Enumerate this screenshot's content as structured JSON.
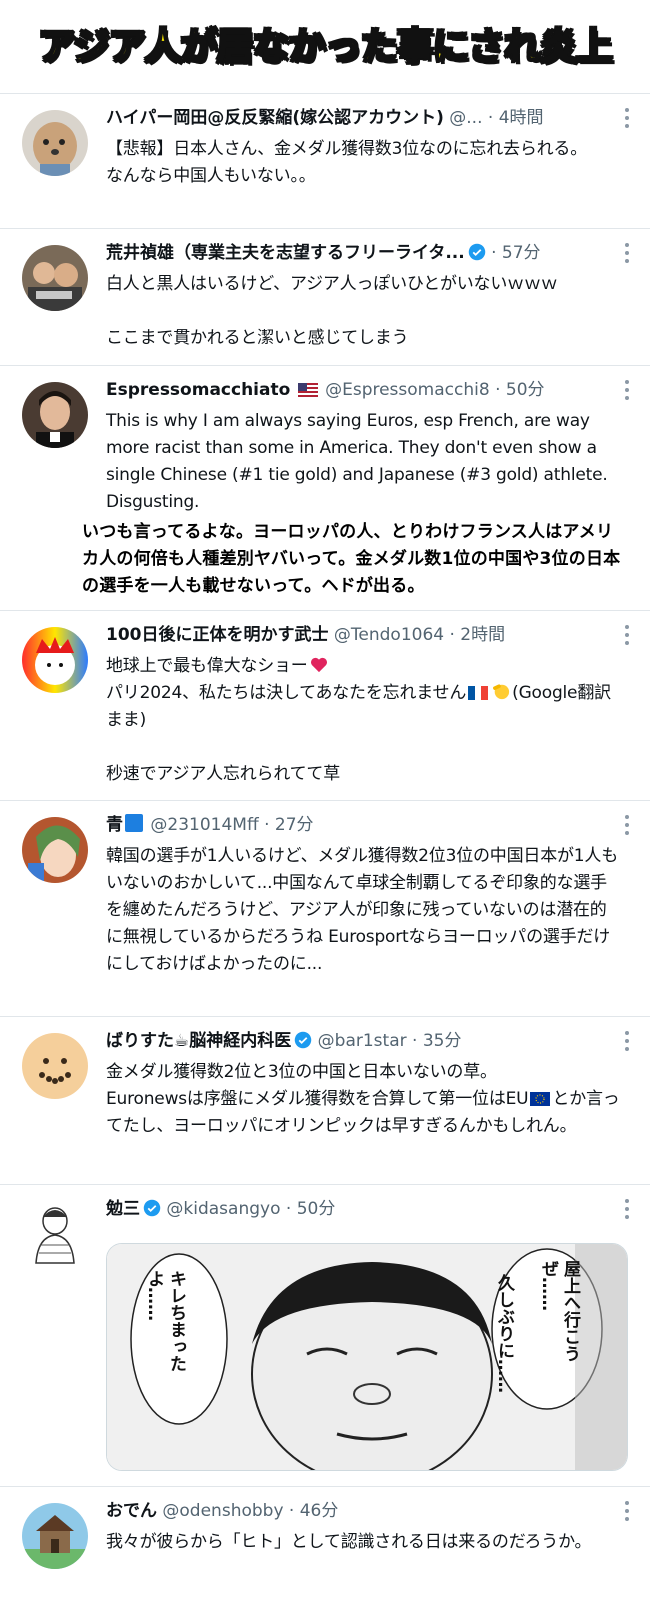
{
  "banner": {
    "title": "アジア人が居なかった事にされ炎上"
  },
  "posts": [
    {
      "name": "ハイパー岡田@反反緊縮(嫁公認アカウント)",
      "handle": "@...",
      "time": "· 4時間",
      "text": "【悲報】日本人さん、金メダル獲得数3位なのに忘れ去られる。\nなんなら中国人もいない。。"
    },
    {
      "name": "荒井禎雄（専業主夫を志望するフリーライタ...",
      "verified": true,
      "time": "· 57分",
      "text": "白人と黒人はいるけど、アジア人っぽいひとがいないｗｗｗ\n\nここまで貫かれると潔いと感じてしまう"
    },
    {
      "name": "Espressomacchiato",
      "flag_icon": "us-flag-icon",
      "handle": "@Espressomacchi8",
      "time": "· 50分",
      "text": "This is why I am always saying Euros, esp French, are way more racist than some in America. They don't even show a single Chinese (#1 tie gold) and Japanese (#3 gold) athlete. Disgusting.",
      "translation": "いつも言ってるよな。ヨーロッパの人、とりわけフランス人はアメリカ人の何倍も人種差別ヤバいって。金メダル数1位の中国や3位の日本の選手を一人も載せないって。ヘドが出る。"
    },
    {
      "name": "100日後に正体を明かす武士",
      "handle": "@Tendo1064",
      "time": "· 2時間",
      "text_line1": "地球上で最も偉大なショー",
      "text_line2a": "パリ2024、私たちは決してあなたを忘れません",
      "text_line2b": "(Google翻訳まま)",
      "text_line3": "秒速でアジア人忘れられてて草"
    },
    {
      "name": "青",
      "handle": "@231014Mff",
      "time": "· 27分",
      "text": "韓国の選手が1人いるけど、メダル獲得数2位3位の中国日本が1人もいないのおかしいて...中国なんて卓球全制覇してるぞ印象的な選手を纏めたんだろうけど、アジア人が印象に残っていないのは潜在的に無視しているからだろうね Eurosportならヨーロッパの選手だけにしておけばよかったのに..."
    },
    {
      "name": "ばりすた☕脳神経内科医",
      "verified": true,
      "handle": "@bar1star",
      "time": "· 35分",
      "text_a": "金メダル獲得数2位と3位の中国と日本いないの草。\nEuronewsは序盤にメダル獲得数を合算して第一位はEU",
      "text_b": "とか言ってたし、ヨーロッパにオリンピックは早すぎるんかもしれん。"
    },
    {
      "name": "勉三",
      "verified": true,
      "handle": "@kidasangyo",
      "time": "· 50分",
      "bubble_left": "キレちまったよ……",
      "bubble_right1": "屋上へ行こうぜ……",
      "bubble_right2": "久しぶりに……"
    },
    {
      "name": "おでん",
      "handle": "@odenshobby",
      "time": "· 46分",
      "text": "我々が彼らから「ヒト」として認識される日は来るのだろうか。"
    }
  ],
  "colors": {
    "verified": "#1d9bf0",
    "banner_fill": "#f5e400",
    "meta": "#536471"
  }
}
